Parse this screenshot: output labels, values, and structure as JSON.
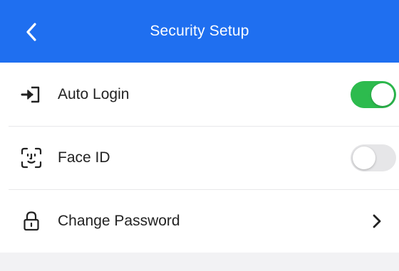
{
  "header": {
    "title": "Security Setup",
    "back_icon": "chevron-left-icon",
    "background_color": "#1f6ff0"
  },
  "settings": [
    {
      "icon": "login-icon",
      "label": "Auto Login",
      "control": "toggle",
      "enabled": true
    },
    {
      "icon": "face-id-icon",
      "label": "Face ID",
      "control": "toggle",
      "enabled": false
    },
    {
      "icon": "lock-icon",
      "label": "Change Password",
      "control": "chevron",
      "chevron_icon": "chevron-right-icon"
    }
  ],
  "colors": {
    "toggle_on": "#2dbb4e",
    "toggle_off": "#e6e6e8"
  }
}
